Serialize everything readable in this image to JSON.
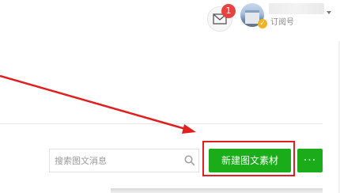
{
  "header": {
    "notification_count": "1",
    "account_type": "订阅号"
  },
  "toolbar": {
    "search_placeholder": "搜索图文消息",
    "new_material_label": "新建图文素材",
    "more_label": "···"
  },
  "colors": {
    "primary_green": "#1aad19",
    "annotation_red": "#e02020",
    "badge_red": "#e64340"
  },
  "icons": [
    "mail-icon",
    "search-icon",
    "verified-icon",
    "chevron-down-icon"
  ]
}
